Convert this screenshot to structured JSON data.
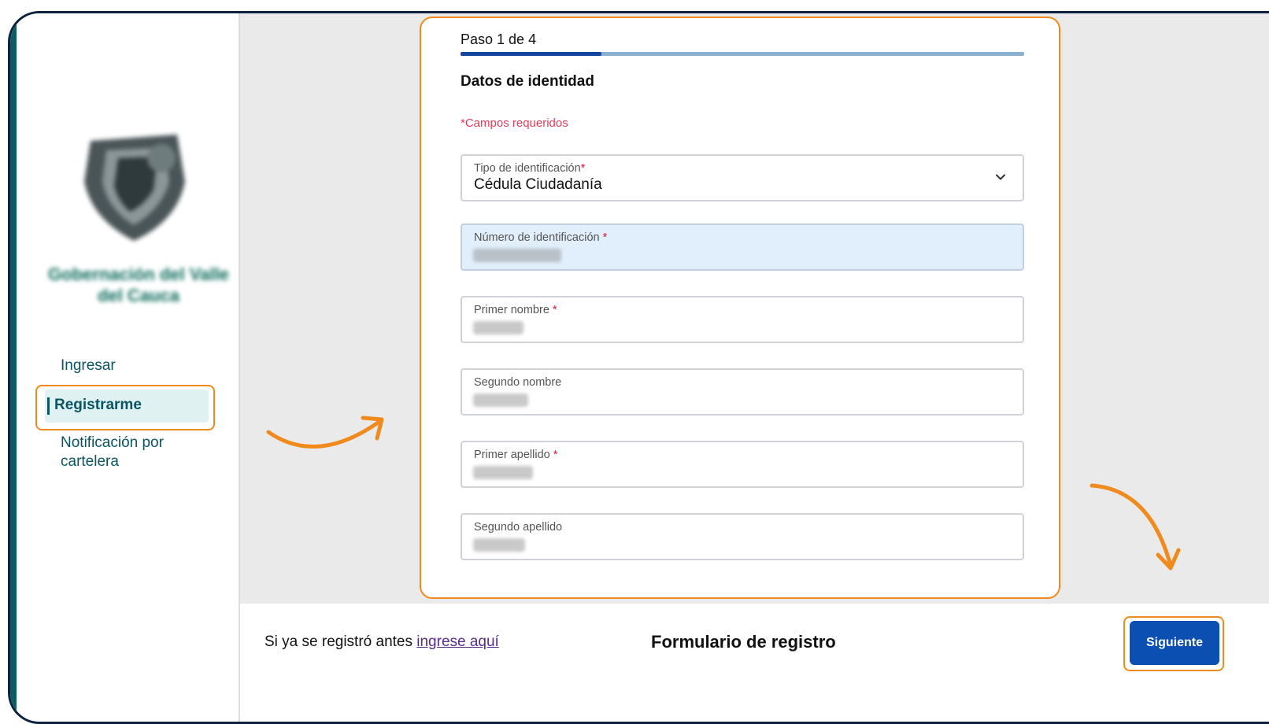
{
  "sidebar": {
    "org_name": "Gobernación del Valle del Cauca",
    "nav": [
      {
        "label": "Ingresar"
      },
      {
        "label": "Registrarme"
      },
      {
        "label": "Notificación por cartelera"
      }
    ]
  },
  "form": {
    "step": "Paso 1 de 4",
    "progress_fraction": 0.25,
    "section_title": "Datos de identidad",
    "required_note": "*Campos requeridos",
    "fields": {
      "tipo": {
        "label": "Tipo de identificación",
        "required_mark": "*",
        "value": "Cédula Ciudadanía"
      },
      "numero": {
        "label": "Número de identificación",
        "required_mark": "*"
      },
      "primer_nombre": {
        "label": "Primer nombre",
        "required_mark": "*"
      },
      "segundo_nombre": {
        "label": "Segundo nombre"
      },
      "primer_apellido": {
        "label": "Primer apellido",
        "required_mark": "*"
      },
      "segundo_apellido": {
        "label": "Segundo apellido"
      }
    }
  },
  "footer": {
    "prompt": "Si ya se registró antes",
    "link": "ingrese aquí",
    "title": "Formulario de registro",
    "next_label": "Siguiente"
  },
  "colors": {
    "accent_orange": "#f08a1c",
    "primary_blue": "#0b4fb3",
    "teal": "#0b5563"
  },
  "icons": {
    "select": "chevron-down-icon",
    "logo": "shield-logo-icon"
  }
}
